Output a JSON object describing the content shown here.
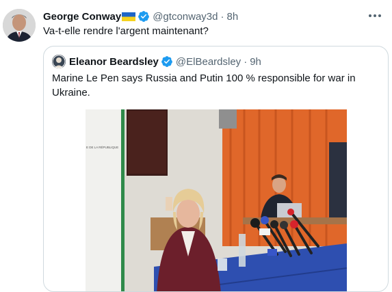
{
  "tweet": {
    "author_name": "George Conway",
    "author_handle": "@gtconway3d",
    "separator": "·",
    "time": "8h",
    "text": "Va-t-elle rendre l'argent maintenant?",
    "verified": true,
    "flag": "ukraine-flag"
  },
  "quote": {
    "author_name": "Eleanor Beardsley",
    "author_handle": "@ElBeardsley",
    "separator": "·",
    "time": "9h",
    "text": "Marine Le Pen says Russia and Putin 100 % responsible for war in Ukraine.",
    "verified": true,
    "photo_wall_text": "E DE LA RÉPUBLIQUE"
  },
  "colors": {
    "verified_blue": "#1d9bf0",
    "secondary_text": "#536471",
    "border": "#cfd9de",
    "curtain_orange": "#e0672a",
    "tablecloth_blue": "#2e4fb0"
  }
}
